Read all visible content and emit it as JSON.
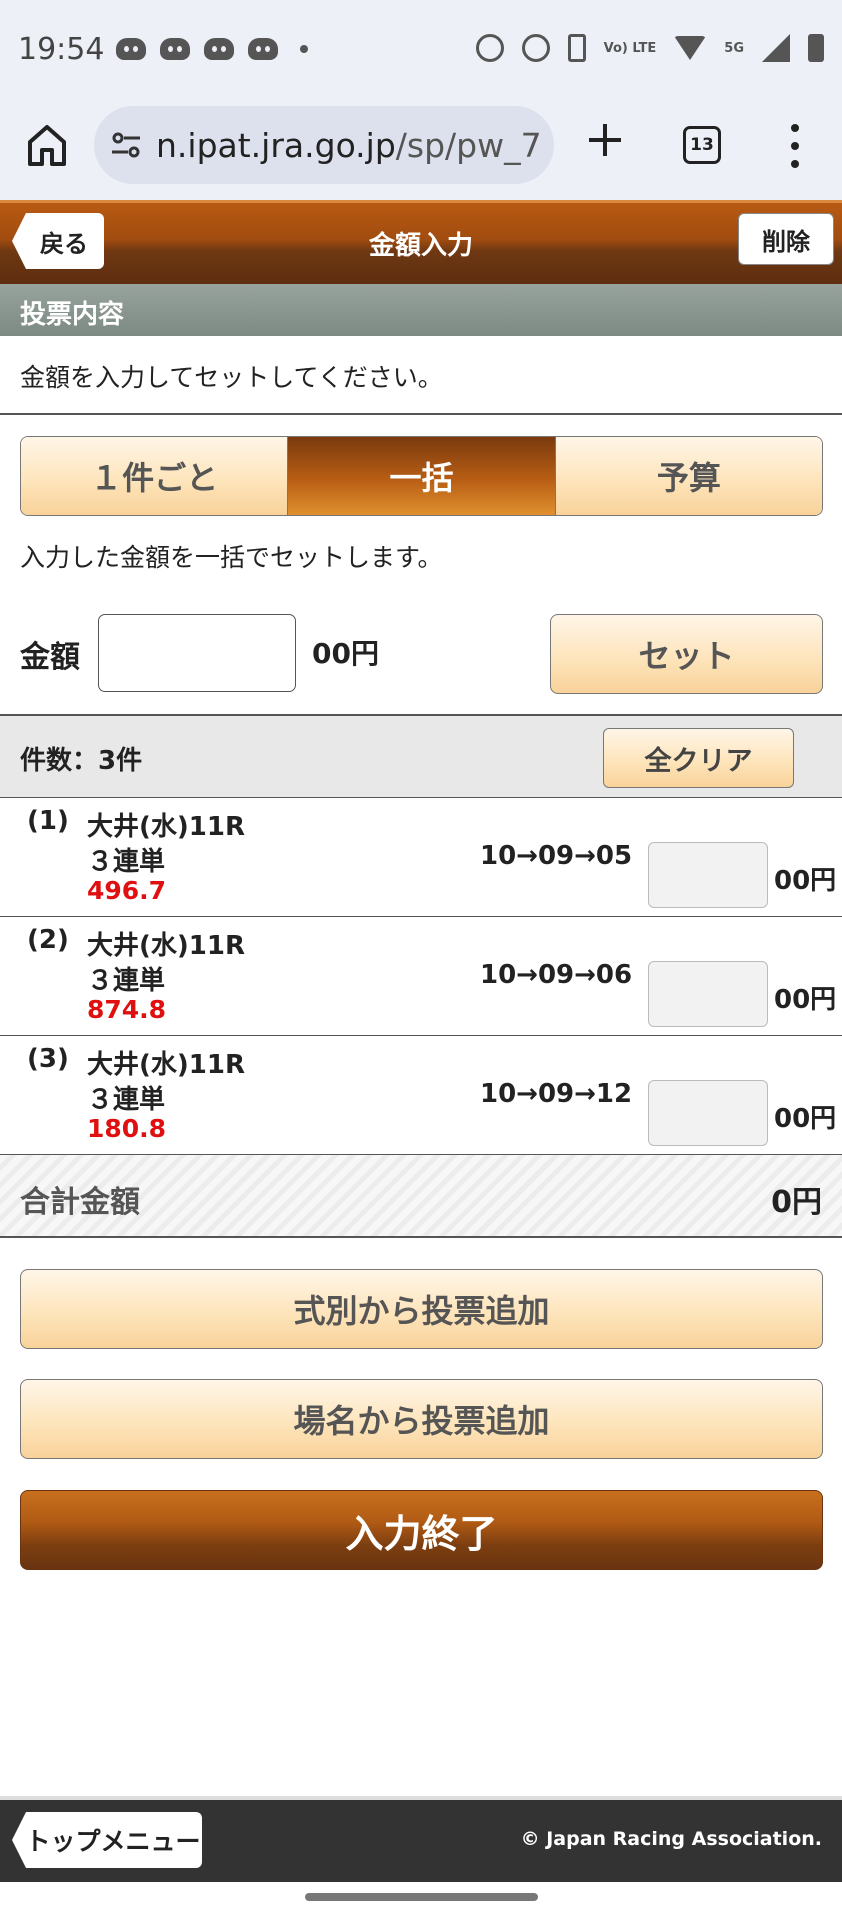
{
  "status_bar": {
    "time": "19:54",
    "net_label": "Vo) LTE",
    "five_g": "5G"
  },
  "browser": {
    "url_host": "n.ipat.jra.go.jp",
    "url_path": "/sp/pw_7",
    "tab_count": "13"
  },
  "header": {
    "back_label": "戻る",
    "title": "金額入力",
    "delete_label": "削除"
  },
  "section": {
    "title": "投票内容",
    "instruction": "金額を入力してセットしてください。"
  },
  "mode_tabs": [
    {
      "label": "１件ごと",
      "active": false
    },
    {
      "label": "一括",
      "active": true
    },
    {
      "label": "予算",
      "active": false
    }
  ],
  "bulk": {
    "description": "入力した金額を一括でセットします。",
    "amount_label": "金額",
    "amount_value": "",
    "suffix": "00円",
    "set_label": "セット"
  },
  "count": {
    "text": "件数：3件",
    "clear_label": "全クリア"
  },
  "bets": [
    {
      "index": "(1)",
      "race": "大井(水)11R",
      "type": "３連単",
      "odds": "496.7",
      "combo": "10→09→05",
      "amount": "",
      "suffix": "00円"
    },
    {
      "index": "(2)",
      "race": "大井(水)11R",
      "type": "３連単",
      "odds": "874.8",
      "combo": "10→09→06",
      "amount": "",
      "suffix": "00円"
    },
    {
      "index": "(3)",
      "race": "大井(水)11R",
      "type": "３連単",
      "odds": "180.8",
      "combo": "10→09→12",
      "amount": "",
      "suffix": "00円"
    }
  ],
  "total": {
    "label": "合計金額",
    "value": "0円"
  },
  "actions": {
    "add_by_type": "式別から投票追加",
    "add_by_venue": "場名から投票追加",
    "finish": "入力終了"
  },
  "footer": {
    "top_menu": "トップメニュー",
    "copyright": "© Japan Racing Association."
  },
  "colors": {
    "accent": "#b85e14",
    "odds_red": "#e01010",
    "button_bg": "#fde3b8",
    "section_bar": "#8a968f"
  }
}
